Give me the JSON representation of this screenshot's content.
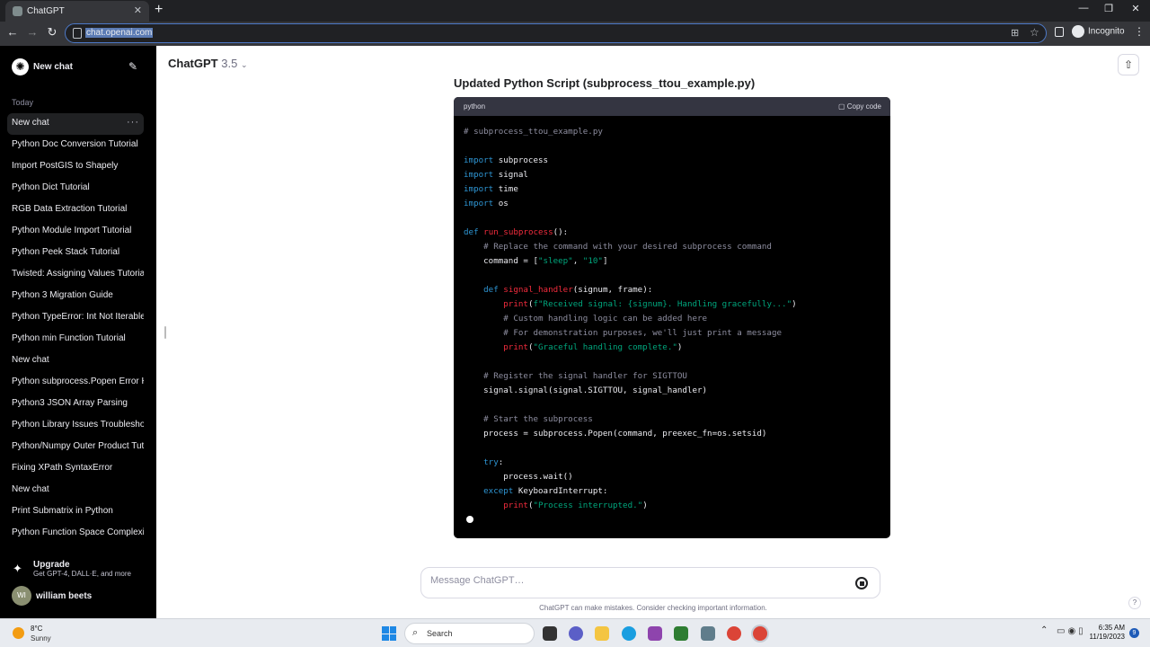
{
  "browser": {
    "tab_title": "ChatGPT",
    "url": "chat.openai.com",
    "incognito_label": "Incognito"
  },
  "sidebar": {
    "new_chat_label": "New chat",
    "section_label": "Today",
    "items": [
      {
        "label": "New chat"
      },
      {
        "label": "Python Doc Conversion Tutorial"
      },
      {
        "label": "Import PostGIS to Shapely"
      },
      {
        "label": "Python Dict Tutorial"
      },
      {
        "label": "RGB Data Extraction Tutorial"
      },
      {
        "label": "Python Module Import Tutorial"
      },
      {
        "label": "Python Peek Stack Tutorial"
      },
      {
        "label": "Twisted: Assigning Values Tutorial"
      },
      {
        "label": "Python 3 Migration Guide"
      },
      {
        "label": "Python TypeError: Int Not Iterable"
      },
      {
        "label": "Python min Function Tutorial"
      },
      {
        "label": "New chat"
      },
      {
        "label": "Python subprocess.Popen Error Handling"
      },
      {
        "label": "Python3 JSON Array Parsing"
      },
      {
        "label": "Python Library Issues Troubleshooting"
      },
      {
        "label": "Python/Numpy Outer Product Tutorial"
      },
      {
        "label": "Fixing XPath SyntaxError"
      },
      {
        "label": "New chat"
      },
      {
        "label": "Print Submatrix in Python"
      },
      {
        "label": "Python Function Space Complexity"
      }
    ],
    "upgrade_title": "Upgrade",
    "upgrade_subtitle": "Get GPT-4, DALL·E, and more",
    "avatar_initials": "WI",
    "user_name": "william beets"
  },
  "main": {
    "model_name": "ChatGPT",
    "model_version": "3.5",
    "heading": "Updated Python Script (subprocess_ttou_example.py)",
    "code_language": "python",
    "copy_label": "Copy code",
    "message_placeholder": "Message ChatGPT…",
    "disclaimer": "ChatGPT can make mistakes. Consider checking important information."
  },
  "code_lines": [
    [
      {
        "c": "cm",
        "t": "# subprocess_ttou_example.py"
      }
    ],
    [],
    [
      {
        "c": "kw",
        "t": "import"
      },
      {
        "t": " subprocess"
      }
    ],
    [
      {
        "c": "kw",
        "t": "import"
      },
      {
        "t": " signal"
      }
    ],
    [
      {
        "c": "kw",
        "t": "import"
      },
      {
        "t": " time"
      }
    ],
    [
      {
        "c": "kw",
        "t": "import"
      },
      {
        "t": " os"
      }
    ],
    [],
    [
      {
        "c": "kw",
        "t": "def"
      },
      {
        "t": " "
      },
      {
        "c": "fn",
        "t": "run_subprocess"
      },
      {
        "t": "():"
      }
    ],
    [
      {
        "t": "    "
      },
      {
        "c": "cm",
        "t": "# Replace the command with your desired subprocess command"
      }
    ],
    [
      {
        "t": "    command = ["
      },
      {
        "c": "st",
        "t": "\"sleep\""
      },
      {
        "t": ", "
      },
      {
        "c": "st",
        "t": "\"10\""
      },
      {
        "t": "]"
      }
    ],
    [],
    [
      {
        "t": "    "
      },
      {
        "c": "kw",
        "t": "def"
      },
      {
        "t": " "
      },
      {
        "c": "fn",
        "t": "signal_handler"
      },
      {
        "t": "(signum, frame):"
      }
    ],
    [
      {
        "t": "        "
      },
      {
        "c": "fn",
        "t": "print"
      },
      {
        "t": "("
      },
      {
        "c": "st",
        "t": "f\"Received signal: {signum}. Handling gracefully...\""
      },
      {
        "t": ")"
      }
    ],
    [
      {
        "t": "        "
      },
      {
        "c": "cm",
        "t": "# Custom handling logic can be added here"
      }
    ],
    [
      {
        "t": "        "
      },
      {
        "c": "cm",
        "t": "# For demonstration purposes, we'll just print a message"
      }
    ],
    [
      {
        "t": "        "
      },
      {
        "c": "fn",
        "t": "print"
      },
      {
        "t": "("
      },
      {
        "c": "st",
        "t": "\"Graceful handling complete.\""
      },
      {
        "t": ")"
      }
    ],
    [],
    [
      {
        "t": "    "
      },
      {
        "c": "cm",
        "t": "# Register the signal handler for SIGTTOU"
      }
    ],
    [
      {
        "t": "    signal.signal(signal.SIGTTOU, signal_handler)"
      }
    ],
    [],
    [
      {
        "t": "    "
      },
      {
        "c": "cm",
        "t": "# Start the subprocess"
      }
    ],
    [
      {
        "t": "    process = subprocess.Popen(command, preexec_fn=os.setsid)"
      }
    ],
    [],
    [
      {
        "t": "    "
      },
      {
        "c": "kw",
        "t": "try"
      },
      {
        "t": ":"
      }
    ],
    [
      {
        "t": "        process.wait()"
      }
    ],
    [
      {
        "t": "    "
      },
      {
        "c": "kw",
        "t": "except"
      },
      {
        "t": " KeyboardInterrupt:"
      }
    ],
    [
      {
        "t": "        "
      },
      {
        "c": "fn",
        "t": "print"
      },
      {
        "t": "("
      },
      {
        "c": "st",
        "t": "\"Process interrupted.\""
      },
      {
        "t": ")"
      }
    ]
  ],
  "taskbar": {
    "temperature": "8°C",
    "condition": "Sunny",
    "search_label": "Search",
    "time": "6:35 AM",
    "date": "11/19/2023",
    "notification_count": "9"
  },
  "colors": {
    "keyword": "#2e95d3",
    "function": "#f22c3d",
    "string": "#00a67d",
    "comment": "#8e8ea0",
    "sidebar_bg": "#000000"
  }
}
